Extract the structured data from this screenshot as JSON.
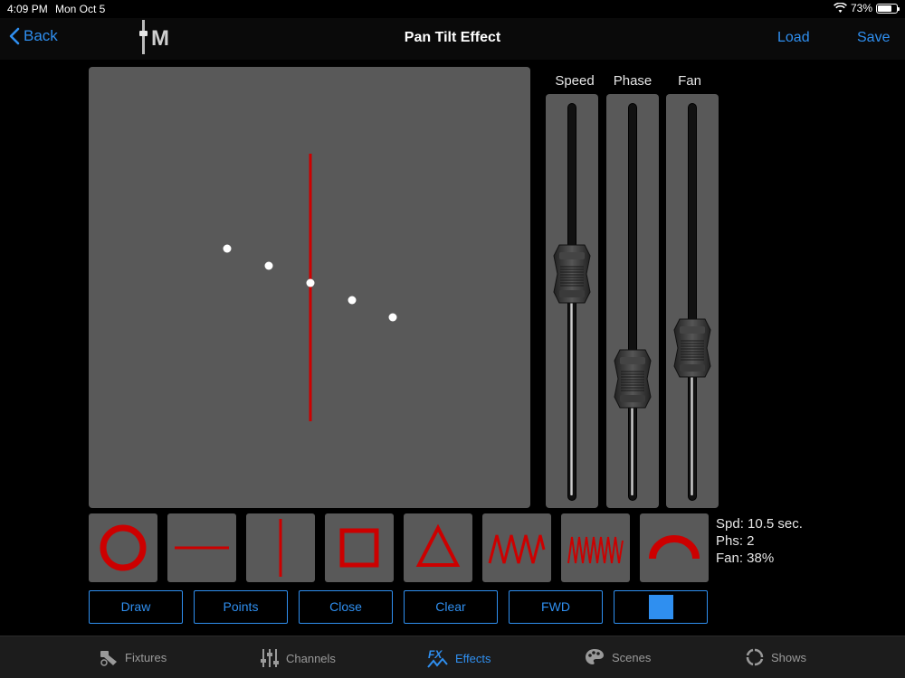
{
  "status": {
    "time": "4:09 PM",
    "date": "Mon Oct 5",
    "battery": "73%",
    "battery_level": 0.73
  },
  "nav": {
    "back_label": "Back",
    "logo_text": "M",
    "title": "Pan Tilt Effect",
    "load_label": "Load",
    "save_label": "Save"
  },
  "pad": {
    "path": "vertical-line",
    "line_color": "#cc0000",
    "points_count": 5
  },
  "faders": [
    {
      "label": "Speed",
      "level": 0.57
    },
    {
      "label": "Phase",
      "level": 0.3
    },
    {
      "label": "Fan",
      "level": 0.38
    }
  ],
  "shapes": [
    "circle-shape-icon",
    "horizontal-line-shape-icon",
    "vertical-line-shape-icon",
    "square-shape-icon",
    "triangle-shape-icon",
    "zigzag-shape-icon",
    "dense-zigzag-shape-icon",
    "arc-shape-icon"
  ],
  "info": {
    "speed": "Spd: 10.5 sec.",
    "phase": "Phs: 2",
    "fan": "Fan: 38%"
  },
  "actions": {
    "draw": "Draw",
    "points": "Points",
    "close": "Close",
    "clear": "Clear",
    "direction": "FWD",
    "stop_icon": "stop-icon"
  },
  "tabs": [
    {
      "label": "Fixtures",
      "icon": "fixtures-icon"
    },
    {
      "label": "Channels",
      "icon": "channels-icon"
    },
    {
      "label": "Effects",
      "icon": "fx-icon",
      "active": true
    },
    {
      "label": "Scenes",
      "icon": "palette-icon"
    },
    {
      "label": "Shows",
      "icon": "shows-icon"
    }
  ],
  "colors": {
    "accent": "#2f8ff0",
    "shape_red": "#cc0000",
    "panel": "#595959"
  }
}
